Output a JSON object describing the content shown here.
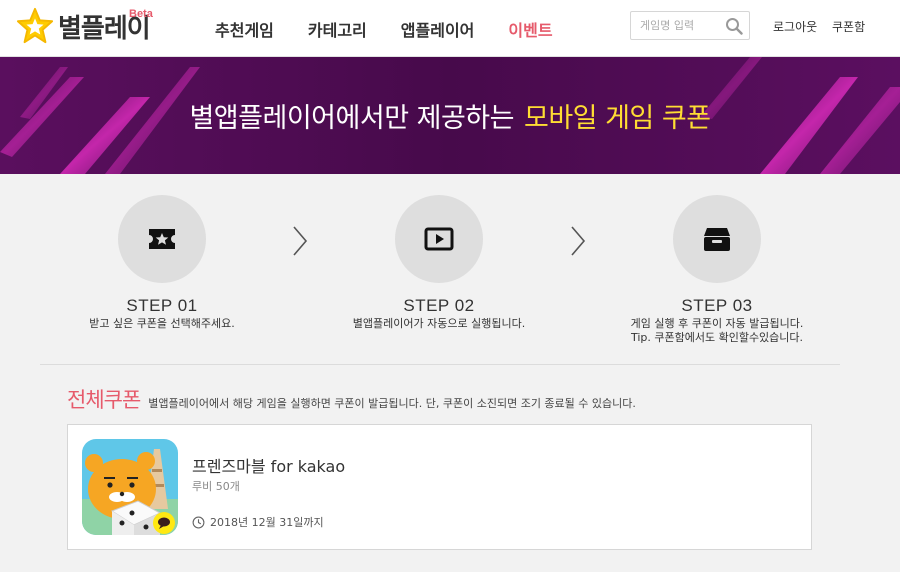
{
  "header": {
    "logo_text": "별플레이",
    "logo_badge": "Beta",
    "nav": [
      "추천게임",
      "카테고리",
      "앱플레이어",
      "이벤트"
    ],
    "nav_active_index": 3,
    "search_placeholder": "게임명 입력",
    "search_value": "",
    "login": "로그아웃",
    "coupon_box": "쿠폰함"
  },
  "banner": {
    "title_plain": "별앱플레이어에서만 제공하는",
    "title_highlight": "모바일 게임 쿠폰"
  },
  "steps": [
    {
      "title": "STEP 01",
      "desc": [
        "받고 싶은 쿠폰을 선택해주세요."
      ],
      "icon": "ticket-star-icon"
    },
    {
      "title": "STEP 02",
      "desc": [
        "별앱플레이어가 자동으로 실행됩니다."
      ],
      "icon": "play-icon"
    },
    {
      "title": "STEP 03",
      "desc": [
        "게임 실행 후 쿠폰이 자동 발급됩니다.",
        "Tip. 쿠폰함에서도 확인할수있습니다."
      ],
      "icon": "coupon-box-icon"
    }
  ],
  "coupons": {
    "section_title": "전체쿠폰",
    "section_desc": "별앱플레이어에서 해당 게임을 실행하면 쿠폰이 발급됩니다. 단, 쿠폰이 소진되면 조기 종료될 수 있습니다.",
    "items": [
      {
        "game": "프렌즈마블 for kakao",
        "reward": "루비 50개",
        "expiry": "2018년 12월 31일까지"
      }
    ]
  },
  "colors": {
    "accent": "#e65a6b",
    "highlight": "#ffdd33",
    "banner_bg": "#4a0b4d",
    "logo_star": "#ffcc00"
  }
}
